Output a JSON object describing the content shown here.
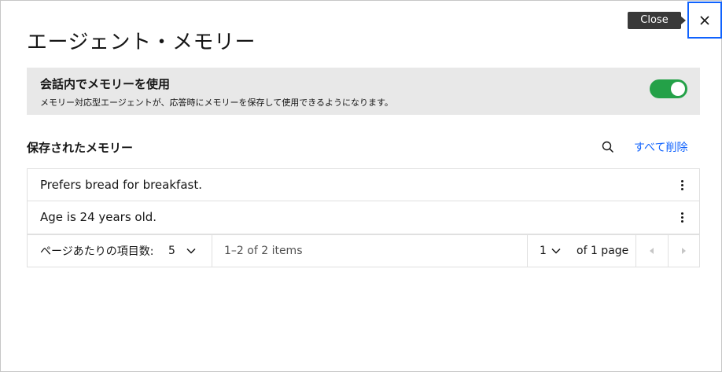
{
  "modal": {
    "title": "エージェント・メモリー",
    "close_tooltip": "Close"
  },
  "memory_toggle": {
    "title": "会話内でメモリーを使用",
    "description": "メモリー対応型エージェントが、応答時にメモリーを保存して使用できるようになります。",
    "enabled": true,
    "color": "#24a148"
  },
  "saved_memories": {
    "title": "保存されたメモリー",
    "delete_all_label": "すべて削除",
    "search_icon": "search-icon",
    "items": [
      {
        "text": "Prefers bread for breakfast."
      },
      {
        "text": "Age is 24 years old."
      }
    ]
  },
  "pagination": {
    "items_per_page_label": "ページあたりの項目数:",
    "items_per_page_value": "5",
    "range_text": "1–2 of 2 items",
    "current_page": "1",
    "of_pages_text": "of 1 page"
  },
  "colors": {
    "accent": "#0f62fe",
    "panel_bg": "#e8e8e8",
    "tooltip_bg": "#393939"
  }
}
